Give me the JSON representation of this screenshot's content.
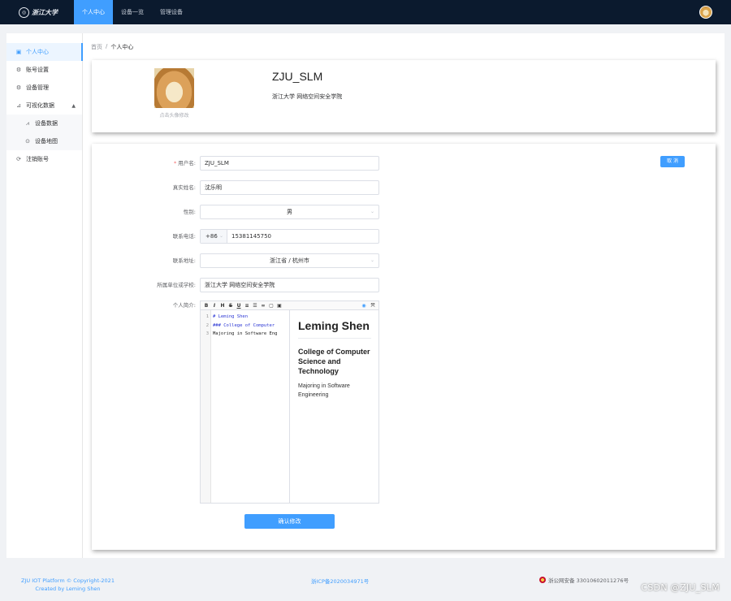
{
  "header": {
    "logo_text": "浙江大学",
    "nav": [
      {
        "label": "个人中心",
        "active": true
      },
      {
        "label": "设备一览",
        "active": false
      },
      {
        "label": "管理设备",
        "active": false
      }
    ]
  },
  "sidebar": {
    "items": [
      {
        "label": "个人中心",
        "icon": "user-card-icon",
        "active": true
      },
      {
        "label": "账号设置",
        "icon": "gear-icon"
      },
      {
        "label": "设备管理",
        "icon": "device-gear-icon"
      },
      {
        "label": "可视化数据",
        "icon": "chart-icon",
        "expanded": true
      },
      {
        "label": "设备数据",
        "icon": "data-chart-icon",
        "sub": true
      },
      {
        "label": "设备地图",
        "icon": "map-pin-icon",
        "sub": true
      },
      {
        "label": "注销账号",
        "icon": "logout-icon"
      }
    ]
  },
  "breadcrumb": {
    "home": "首页",
    "sep": "/",
    "current": "个人中心"
  },
  "profile": {
    "avatar_hint": "点击头像修改",
    "username": "ZJU_SLM",
    "school": "浙江大学 网络空间安全学院"
  },
  "form": {
    "cancel_label": "取 消",
    "username_label": "用户名:",
    "username_value": "ZJU_SLM",
    "realname_label": "真实姓名:",
    "realname_value": "沈乐明",
    "gender_label": "性别:",
    "gender_value": "男",
    "phone_label": "联系电话:",
    "phone_prefix": "+86",
    "phone_value": "15381145750",
    "address_label": "联系地址:",
    "address_value": "浙江省 / 杭州市",
    "org_label": "所属单位或学校:",
    "org_value": "浙江大学 网络空间安全学院",
    "intro_label": "个人简介:",
    "submit_label": "确认修改"
  },
  "editor": {
    "toolbar": [
      "B",
      "I",
      "H",
      "S",
      "U",
      "≡",
      "☰",
      "🔗",
      "▢",
      "▣"
    ],
    "line_numbers": [
      "1",
      "2",
      "3"
    ],
    "code_lines": [
      "# Leming Shen",
      "### College of Computer",
      "Majoring in Software Eng"
    ],
    "preview_h1": "Leming Shen",
    "preview_h2": "College of Computer Science and Technology",
    "preview_p": "Majoring in Software Engineering"
  },
  "footer": {
    "copyright": "ZJU IOT Platform © Copyright-2021",
    "created_by": "Created by Leming Shen",
    "icp": "浙ICP备2020034971号",
    "police": "浙公网安备 33010602011276号"
  },
  "watermark": "CSDN @ZJU_SLM",
  "colors": {
    "primary": "#409eff",
    "topbar": "#0b1a2e"
  }
}
